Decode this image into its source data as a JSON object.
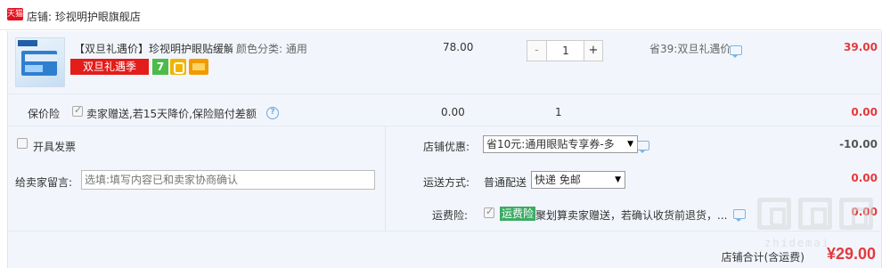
{
  "shop": {
    "badge_text": "天猫",
    "name": "店铺: 珍视明护眼旗舰店"
  },
  "item": {
    "title": "【双旦礼遇价】珍视明护眼贴缓解",
    "sku": "颜色分类: 通用",
    "promo_badge": "双旦礼遇季",
    "service_icon_7": "7",
    "unit_price": "78.00",
    "quantity": "1",
    "qty_minus": "-",
    "qty_plus": "+",
    "saving": "省39:双旦礼遇价",
    "subtotal": "39.00"
  },
  "insurance": {
    "label": "保价险",
    "desc": "卖家赠送,若15天降价,保险赔付差额",
    "price": "0.00",
    "qty": "1",
    "subtotal": "0.00"
  },
  "invoice": {
    "label": "开具发票"
  },
  "message": {
    "label": "给卖家留言:",
    "placeholder": "选填:填写内容已和卖家协商确认"
  },
  "coupon": {
    "label": "店铺优惠:",
    "selected": "省10元:通用眼贴专享券-多",
    "amount": "-10.00"
  },
  "shipping": {
    "label": "运送方式:",
    "normal": "普通配送",
    "selected": "快递 免邮",
    "amount": "0.00"
  },
  "freight_insurance": {
    "label": "运费险:",
    "tag": "运费险",
    "desc": "聚划算卖家赠送，若确认收货前退货，...",
    "amount": "0.00"
  },
  "total": {
    "label": "店铺合计(含运费)",
    "value": "¥29.00"
  },
  "watermark": {
    "text": "zhidemai"
  },
  "colors": {
    "accent_red": "#e4393c",
    "row_bg": "#f2f6fc",
    "freight_tag_green": "#3cab64"
  }
}
